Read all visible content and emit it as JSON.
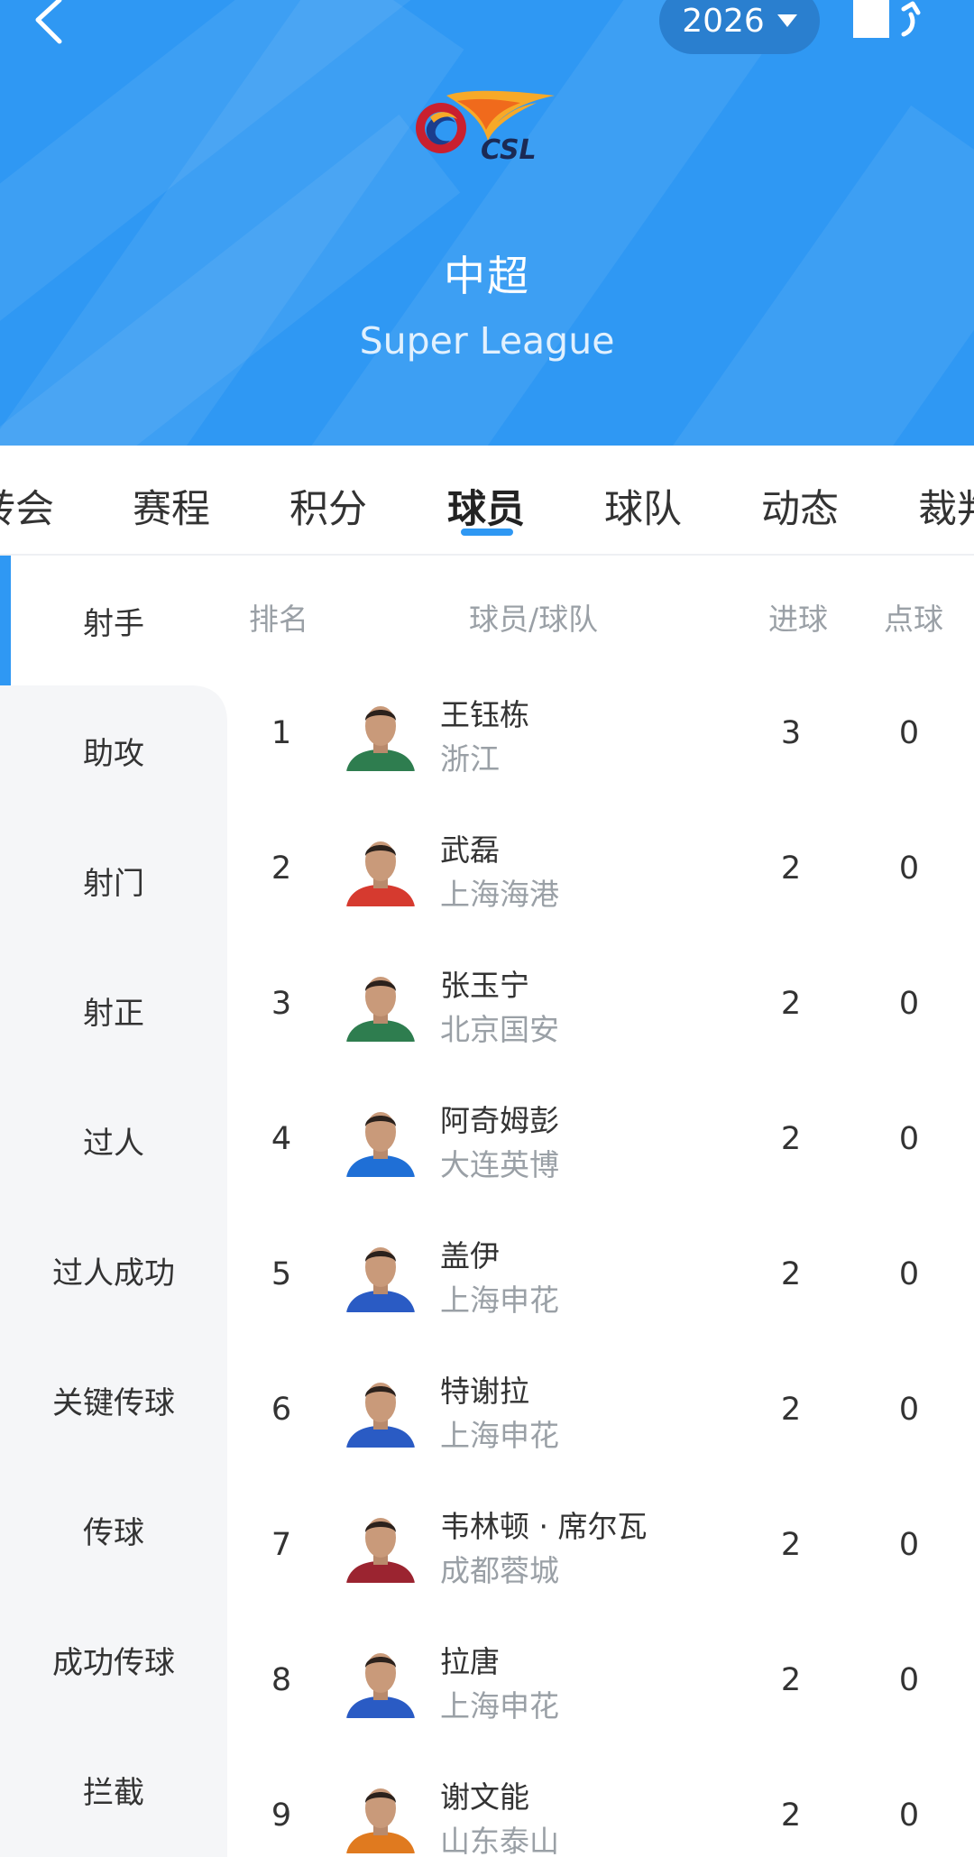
{
  "header": {
    "year": "2026",
    "title_cn": "中超",
    "title_en": "Super League",
    "logo_text": "CSL",
    "bg_color": "#2f98f3"
  },
  "tabs": [
    {
      "label": "转会",
      "active": false
    },
    {
      "label": "赛程",
      "active": false
    },
    {
      "label": "积分",
      "active": false
    },
    {
      "label": "球员",
      "active": true
    },
    {
      "label": "球队",
      "active": false
    },
    {
      "label": "动态",
      "active": false
    },
    {
      "label": "裁判",
      "active": false
    }
  ],
  "sidebar": {
    "items": [
      {
        "label": "射手",
        "active": true
      },
      {
        "label": "助攻",
        "active": false
      },
      {
        "label": "射门",
        "active": false
      },
      {
        "label": "射正",
        "active": false
      },
      {
        "label": "过人",
        "active": false
      },
      {
        "label": "过人成功",
        "active": false
      },
      {
        "label": "关键传球",
        "active": false
      },
      {
        "label": "传球",
        "active": false
      },
      {
        "label": "成功传球",
        "active": false
      },
      {
        "label": "拦截",
        "active": false
      }
    ]
  },
  "table": {
    "columns": {
      "rank": "排名",
      "player_team": "球员/球队",
      "goals": "进球",
      "penalties": "点球"
    },
    "rows": [
      {
        "rank": "1",
        "name": "王钰栋",
        "team": "浙江",
        "goals": "3",
        "penalties": "0",
        "kit_color": "#2e7d4f"
      },
      {
        "rank": "2",
        "name": "武磊",
        "team": "上海海港",
        "goals": "2",
        "penalties": "0",
        "kit_color": "#d63a2f"
      },
      {
        "rank": "3",
        "name": "张玉宁",
        "team": "北京国安",
        "goals": "2",
        "penalties": "0",
        "kit_color": "#2e7d4f"
      },
      {
        "rank": "4",
        "name": "阿奇姆彭",
        "team": "大连英博",
        "goals": "2",
        "penalties": "0",
        "kit_color": "#1f6fd6"
      },
      {
        "rank": "5",
        "name": "盖伊",
        "team": "上海申花",
        "goals": "2",
        "penalties": "0",
        "kit_color": "#2a5bc4"
      },
      {
        "rank": "6",
        "name": "特谢拉",
        "team": "上海申花",
        "goals": "2",
        "penalties": "0",
        "kit_color": "#2a5bc4"
      },
      {
        "rank": "7",
        "name": "韦林顿 · 席尔瓦",
        "team": "成都蓉城",
        "goals": "2",
        "penalties": "0",
        "kit_color": "#9b2430"
      },
      {
        "rank": "8",
        "name": "拉唐",
        "team": "上海申花",
        "goals": "2",
        "penalties": "0",
        "kit_color": "#2a5bc4"
      },
      {
        "rank": "9",
        "name": "谢文能",
        "team": "山东泰山",
        "goals": "2",
        "penalties": "0",
        "kit_color": "#e07a1f"
      }
    ]
  }
}
